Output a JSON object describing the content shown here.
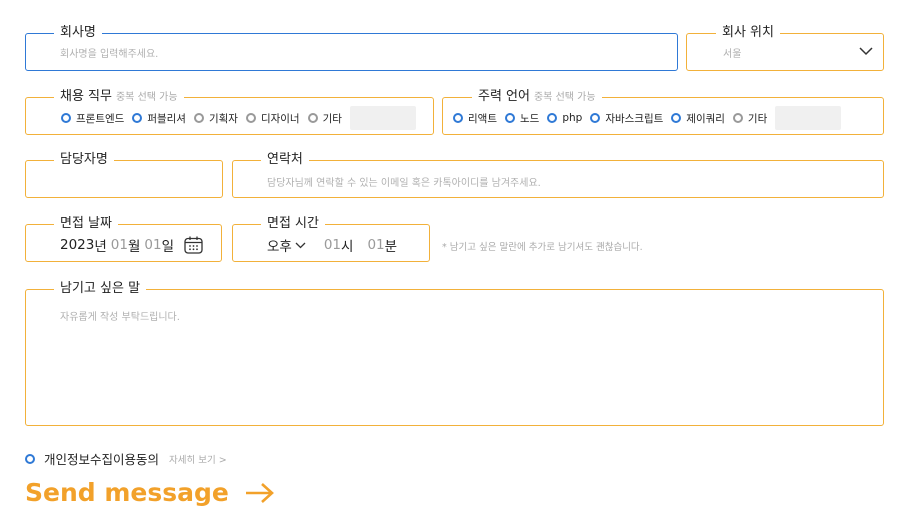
{
  "form": {
    "company_name": {
      "label": "회사명",
      "placeholder": "회사명을 입력해주세요."
    },
    "company_location": {
      "label": "회사 위치",
      "value": "서울"
    },
    "positions": {
      "label": "채용 직무",
      "hint": "중복 선택 가능",
      "options": [
        "프론트엔드",
        "퍼블리셔",
        "기획자",
        "디자이너",
        "기타"
      ]
    },
    "languages": {
      "label": "주력 언어",
      "hint": "중복 선택 가능",
      "options": [
        "리액트",
        "노드",
        "php",
        "자바스크립트",
        "제이쿼리",
        "기타"
      ]
    },
    "manager_name": {
      "label": "담당자명"
    },
    "contact": {
      "label": "연락처",
      "placeholder": "담당자님께 연락할 수 있는 이메일 혹은 카톡아이디를 남겨주세요."
    },
    "interview_date": {
      "label": "면접 날짜",
      "year": "2023",
      "year_unit": "년",
      "month": "01",
      "month_unit": "월",
      "day": "01",
      "day_unit": "일"
    },
    "interview_time": {
      "label": "면접 시간",
      "ampm": "오후",
      "hour": "01",
      "hour_unit": "시",
      "minute": "01",
      "minute_unit": "분"
    },
    "time_note": "* 남기고 싶은 말란에 추가로 남기셔도 괜찮습니다.",
    "message": {
      "label": "남기고 싶은 말",
      "placeholder": "자유롭게 작성 부탁드립니다."
    },
    "consent": {
      "label": "개인정보수집이용동의",
      "more": "자세히 보기 >"
    },
    "send_label": "Send message"
  },
  "colors": {
    "accent": "#f2b13a",
    "active": "#2f79d6",
    "send": "#f2a12a"
  }
}
